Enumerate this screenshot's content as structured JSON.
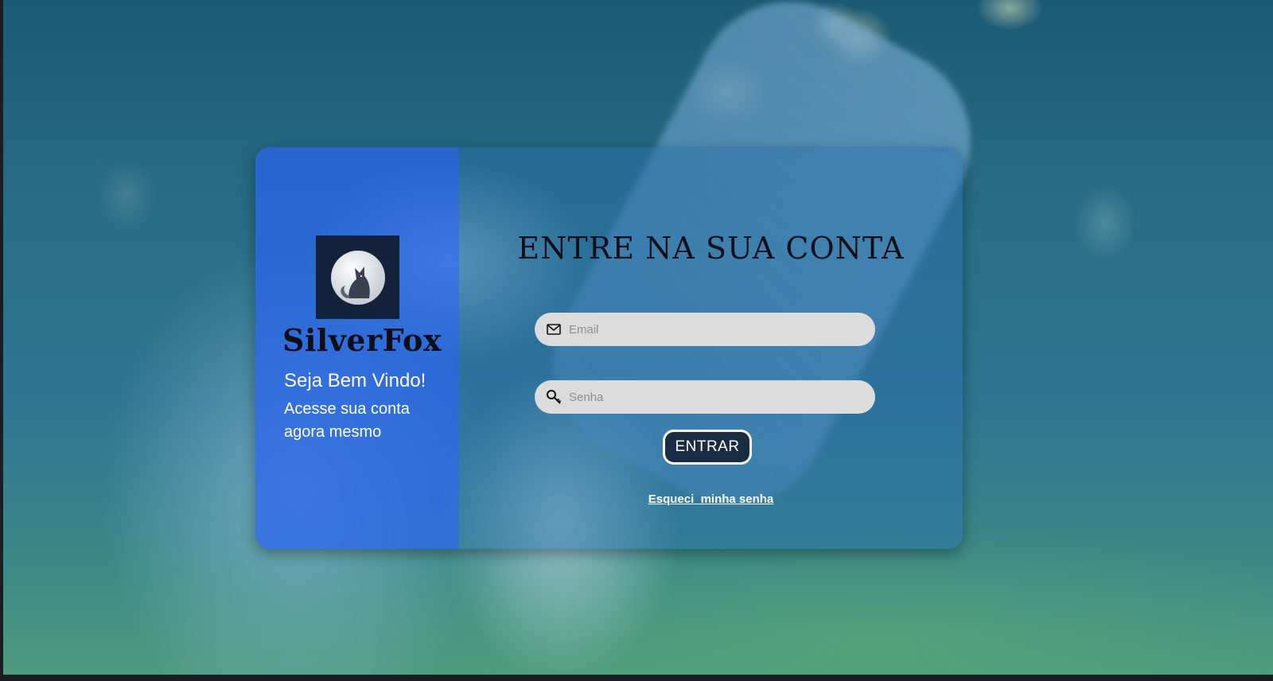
{
  "brand": {
    "name": "SilverFox",
    "logo_icon": "fox-logo-icon"
  },
  "left_panel": {
    "welcome": "Seja Bem Vindo!",
    "subtitle": "Acesse sua conta agora mesmo",
    "color": "#2864f0"
  },
  "login": {
    "title": "ENTRE NA SUA CONTA",
    "email": {
      "placeholder": "Email",
      "value": "",
      "icon": "mail-icon"
    },
    "senha": {
      "placeholder": "Senha",
      "value": "",
      "icon": "key-icon"
    },
    "submit_label": "ENTRAR",
    "forgot_label": "Esqueci  minha senha"
  },
  "background": {
    "image": "dog-paw-hand-photo"
  }
}
